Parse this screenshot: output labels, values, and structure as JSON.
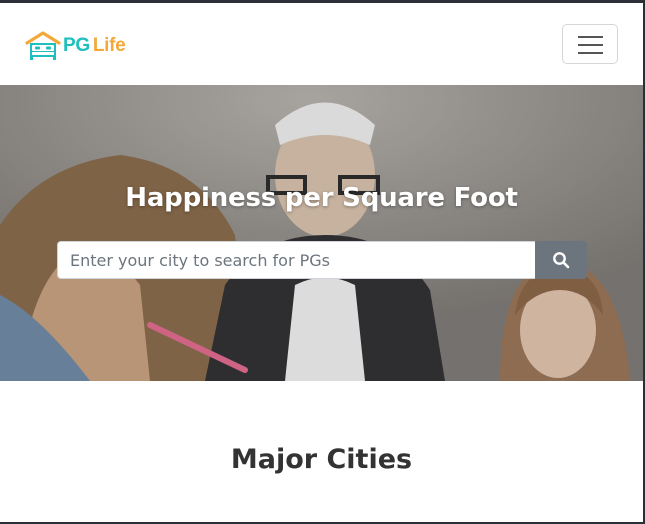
{
  "navbar": {
    "brand": {
      "primary": "PG",
      "secondary": "Life",
      "icon": "house-logo-icon"
    },
    "menu_icon": "hamburger-menu-icon"
  },
  "hero": {
    "title": "Happiness per Square Foot",
    "search": {
      "placeholder": "Enter your city to search for PGs",
      "value": "",
      "button_icon": "search-icon"
    }
  },
  "cities_section": {
    "title": "Major Cities"
  },
  "colors": {
    "brand_teal": "#1fbfc0",
    "brand_orange": "#f3a93a",
    "search_button": "#6c757d",
    "text_dark": "#333333"
  }
}
